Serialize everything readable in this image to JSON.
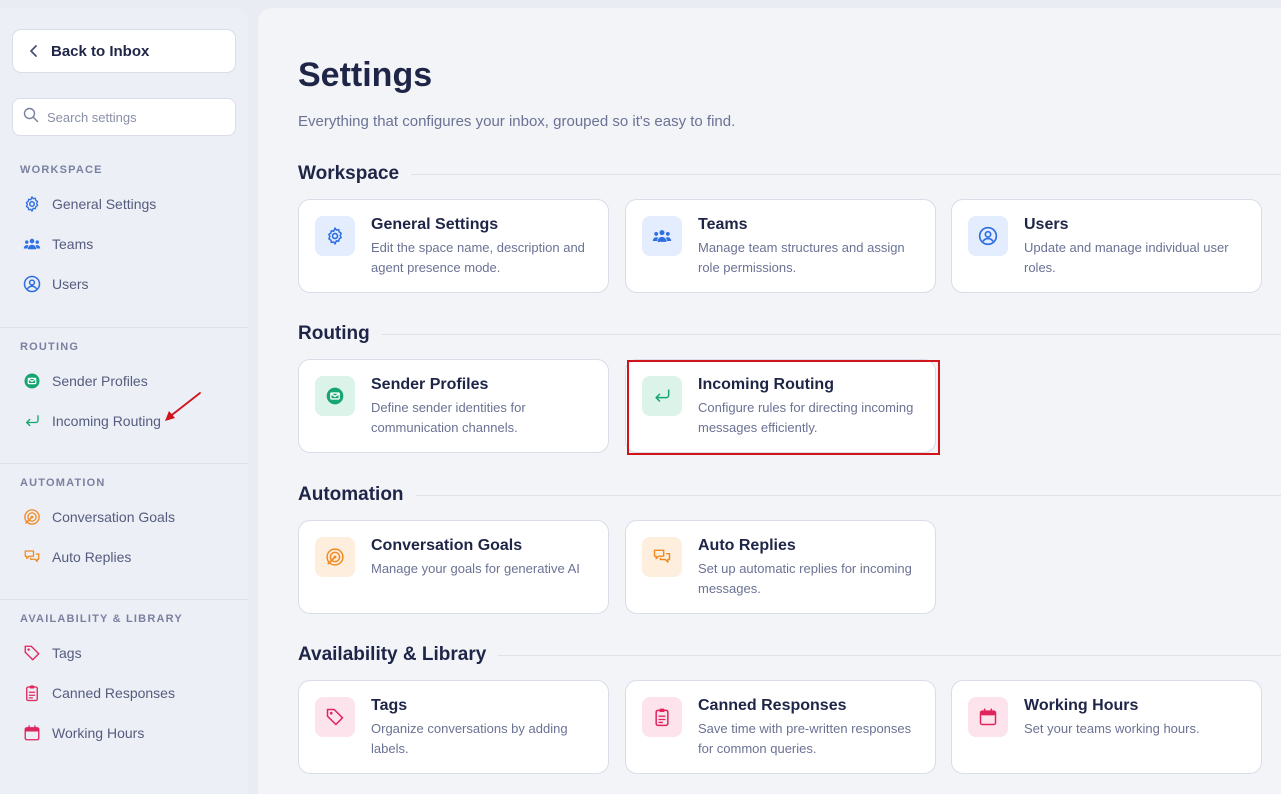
{
  "sidebar": {
    "back_label": "Back to Inbox",
    "search_placeholder": "Search settings",
    "sections": [
      {
        "heading": "WORKSPACE",
        "items": [
          {
            "label": "General Settings",
            "icon": "gear-icon"
          },
          {
            "label": "Teams",
            "icon": "teams-icon"
          },
          {
            "label": "Users",
            "icon": "user-icon"
          }
        ]
      },
      {
        "heading": "ROUTING",
        "items": [
          {
            "label": "Sender Profiles",
            "icon": "mail-icon"
          },
          {
            "label": "Incoming Routing",
            "icon": "return-arrow-icon"
          }
        ]
      },
      {
        "heading": "AUTOMATION",
        "items": [
          {
            "label": "Conversation Goals",
            "icon": "target-icon"
          },
          {
            "label": "Auto Replies",
            "icon": "chat-bubbles-icon"
          }
        ]
      },
      {
        "heading": "AVAILABILITY & LIBRARY",
        "items": [
          {
            "label": "Tags",
            "icon": "tag-icon"
          },
          {
            "label": "Canned Responses",
            "icon": "clipboard-icon"
          },
          {
            "label": "Working Hours",
            "icon": "calendar-icon"
          }
        ]
      }
    ]
  },
  "main": {
    "title": "Settings",
    "subtitle": "Everything that configures your inbox, grouped so it's easy to find.",
    "groups": [
      {
        "title": "Workspace",
        "cards": [
          {
            "title": "General Settings",
            "desc": "Edit the space name, description and agent presence mode.",
            "icon": "gear-icon"
          },
          {
            "title": "Teams",
            "desc": "Manage team structures and assign role permissions.",
            "icon": "teams-icon"
          },
          {
            "title": "Users",
            "desc": "Update and manage individual user roles.",
            "icon": "user-icon"
          }
        ]
      },
      {
        "title": "Routing",
        "cards": [
          {
            "title": "Sender Profiles",
            "desc": "Define sender identities for communication channels.",
            "icon": "mail-icon"
          },
          {
            "title": "Incoming Routing",
            "desc": "Configure rules for directing incoming messages efficiently.",
            "icon": "return-arrow-icon"
          }
        ]
      },
      {
        "title": "Automation",
        "cards": [
          {
            "title": "Conversation Goals",
            "desc": "Manage your goals for generative AI",
            "icon": "target-icon"
          },
          {
            "title": "Auto Replies",
            "desc": "Set up automatic replies for incoming messages.",
            "icon": "chat-bubbles-icon"
          }
        ]
      },
      {
        "title": "Availability & Library",
        "cards": [
          {
            "title": "Tags",
            "desc": "Organize conversations by adding labels.",
            "icon": "tag-icon"
          },
          {
            "title": "Canned Responses",
            "desc": "Save time with pre-written responses for common queries.",
            "icon": "clipboard-icon"
          },
          {
            "title": "Working Hours",
            "desc": "Set your teams working hours.",
            "icon": "calendar-icon"
          }
        ]
      }
    ]
  },
  "colors": {
    "blue": "#2f6fe4",
    "blue_bg": "#e3edfd",
    "green": "#17a672",
    "green_bg": "#dcf3ea",
    "orange": "#f08a24",
    "orange_bg": "#fdeedd",
    "pink": "#e0245e",
    "pink_bg": "#fde3ec",
    "annotation_red": "#d0141c"
  }
}
